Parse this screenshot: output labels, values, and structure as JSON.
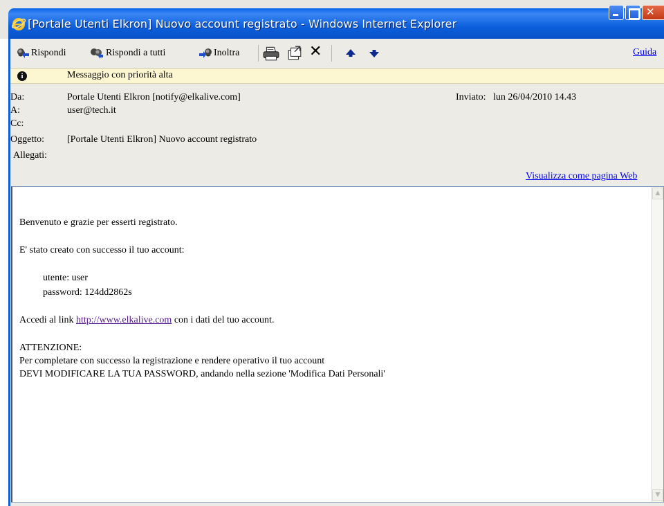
{
  "window": {
    "title": "[Portale Utenti Elkron] Nuovo account registrato - Windows Internet Explorer"
  },
  "toolbar": {
    "reply_label": "Rispondi",
    "reply_all_label": "Rispondi a tutti",
    "forward_label": "Inoltra",
    "help_label": "Guida"
  },
  "priority": {
    "text": "Messaggio con priorità alta"
  },
  "header": {
    "from_label": "Da:",
    "from_value": "Portale Utenti Elkron [notify@elkalive.com]",
    "sent_label": "Inviato:",
    "sent_value": "lun 26/04/2010 14.43",
    "to_label": "A:",
    "to_value": "user@tech.it",
    "cc_label": "Cc:",
    "subject_label": "Oggetto:",
    "subject_value": "[Portale Utenti Elkron] Nuovo account registrato",
    "attachments_label": "Allegati:",
    "view_as_web_label": "Visualizza come pagina Web"
  },
  "message": {
    "line1": "Benvenuto e grazie per esserti registrato.",
    "line2": "E' stato creato con successo il tuo account:",
    "user_line": "utente:  user",
    "password_line": "password:  124dd2862s",
    "access_prefix": "Accedi al link ",
    "access_link": "http://www.elkalive.com",
    "access_suffix": " con i dati del tuo account.",
    "attention": "ATTENZIONE:",
    "instr1": "Per completare con successo la registrazione e rendere operativo il tuo account",
    "instr2": "DEVI MODIFICARE LA TUA PASSWORD, andando nella sezione 'Modifica Dati Personali'"
  }
}
